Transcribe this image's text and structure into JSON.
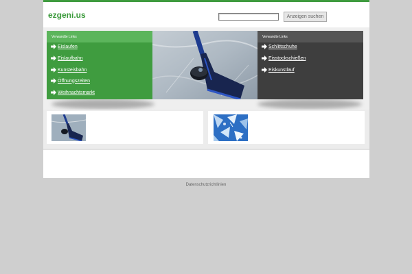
{
  "header": {
    "logo": "ezgeni.us",
    "search": {
      "value": "",
      "button_label": "Anzeigen suchen"
    }
  },
  "left_box": {
    "title": "Verwandte Links",
    "links": [
      "Eislaufen",
      "Eislaufbahn",
      "Kunsteisbahn",
      "Öffnungszeiten",
      "Weihnachtsmarkt"
    ]
  },
  "right_box": {
    "title": "Verwandte Links",
    "links": [
      "Schlittschuhe",
      "Eisstockschießen",
      "Eiskunstlauf"
    ]
  },
  "footer": {
    "privacy_link": "Datenschutzrichtlinien"
  },
  "colors": {
    "accent_green": "#3f9b3f",
    "box_green": "#3f9c3f",
    "box_dark": "#3e3e3e",
    "page_bg": "#cfcfcf"
  },
  "icons": {
    "link_arrow": "arrow-right-icon"
  }
}
